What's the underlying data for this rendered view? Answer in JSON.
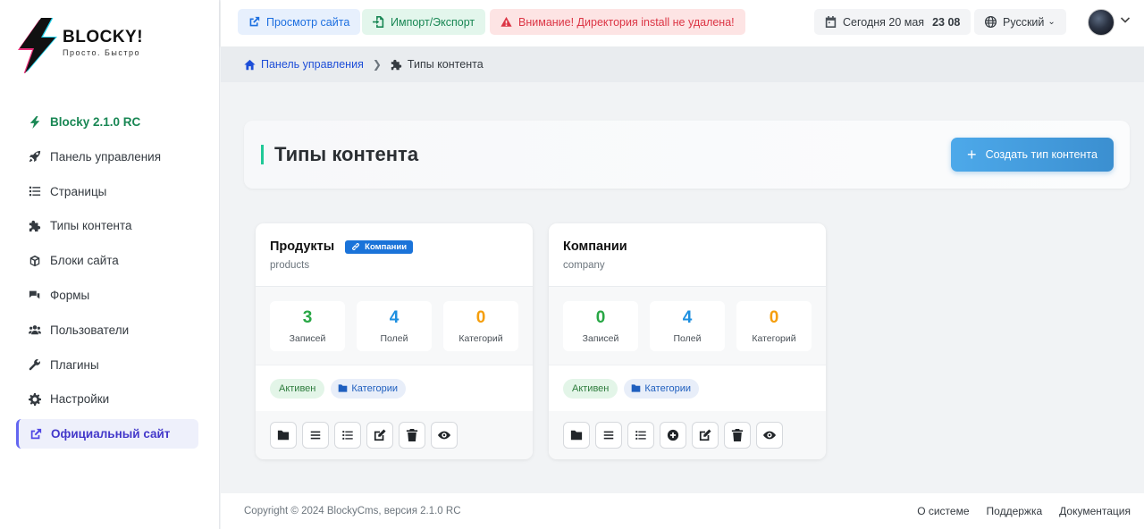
{
  "brand": {
    "title": "BLOCKY!",
    "subtitle": "Просто. Быстро"
  },
  "sidebar": {
    "items": [
      {
        "label": "Blocky 2.1.0 RC",
        "icon": "bolt-icon"
      },
      {
        "label": "Панель управления",
        "icon": "rocket-icon"
      },
      {
        "label": "Страницы",
        "icon": "list-icon"
      },
      {
        "label": "Типы контента",
        "icon": "puzzle-icon"
      },
      {
        "label": "Блоки сайта",
        "icon": "cube-icon"
      },
      {
        "label": "Формы",
        "icon": "comments-icon"
      },
      {
        "label": "Пользователи",
        "icon": "users-icon"
      },
      {
        "label": "Плагины",
        "icon": "wrench-icon"
      },
      {
        "label": "Настройки",
        "icon": "gear-icon"
      },
      {
        "label": "Официальный сайт",
        "icon": "external-link-icon"
      }
    ]
  },
  "topbar": {
    "view_site": "Просмотр сайта",
    "import_export": "Импорт/Экспорт",
    "warning": "Внимание! Директория install не удалена!",
    "date_label": "Сегодня 20 мая",
    "time": "23 08",
    "language": "Русский"
  },
  "breadcrumb": {
    "home": "Панель управления",
    "current": "Типы контента"
  },
  "page": {
    "title": "Типы контента",
    "create_button": "Создать тип контента"
  },
  "cards": [
    {
      "title": "Продукты",
      "relation": "Компании",
      "slug": "products",
      "stats": [
        {
          "value": "3",
          "label": "Записей"
        },
        {
          "value": "4",
          "label": "Полей"
        },
        {
          "value": "0",
          "label": "Категорий"
        }
      ],
      "status": "Активен",
      "categories": "Категории"
    },
    {
      "title": "Компании",
      "slug": "company",
      "stats": [
        {
          "value": "0",
          "label": "Записей"
        },
        {
          "value": "4",
          "label": "Полей"
        },
        {
          "value": "0",
          "label": "Категорий"
        }
      ],
      "status": "Активен",
      "categories": "Категории"
    }
  ],
  "footer": {
    "copyright": "Copyright © 2024 BlockyCms, версия 2.1.0 RC",
    "links": [
      "О системе",
      "Поддержка",
      "Документация"
    ]
  },
  "colors": {
    "accent": "#4da9ea",
    "active_nav": "#4338ca",
    "version": "#198754",
    "warning": "#dc3545"
  }
}
